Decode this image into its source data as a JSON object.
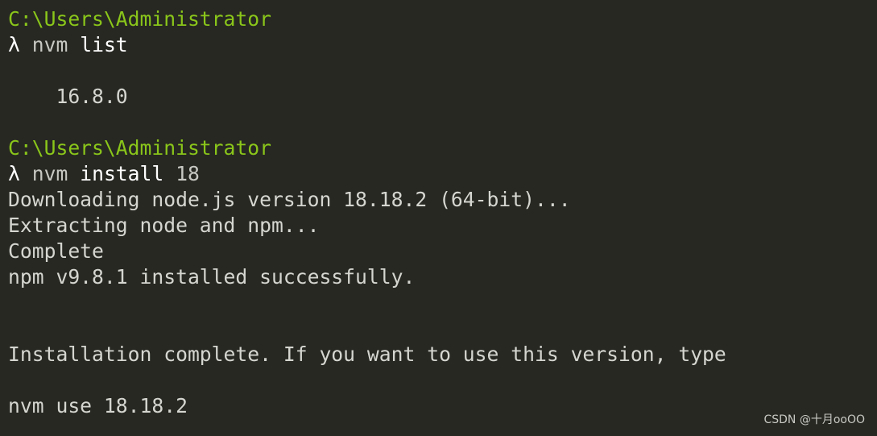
{
  "terminal": {
    "colors": {
      "background": "#272822",
      "prompt_path": "#8ac61a",
      "text": "#d6d6d0"
    },
    "block1": {
      "path": "C:\\Users\\Administrator",
      "prompt": "λ",
      "command": "nvm",
      "args": "list",
      "output": [
        "    16.8.0"
      ]
    },
    "block2": {
      "path": "C:\\Users\\Administrator",
      "prompt": "λ",
      "command": "nvm",
      "args": "install",
      "version_arg": "18",
      "output": [
        "Downloading node.js version 18.18.2 (64-bit)...",
        "Extracting node and npm...",
        "Complete",
        "npm v9.8.1 installed successfully.",
        "Installation complete. If you want to use this version, type",
        "nvm use 18.18.2"
      ]
    }
  },
  "watermark": "CSDN @十月ooOO"
}
